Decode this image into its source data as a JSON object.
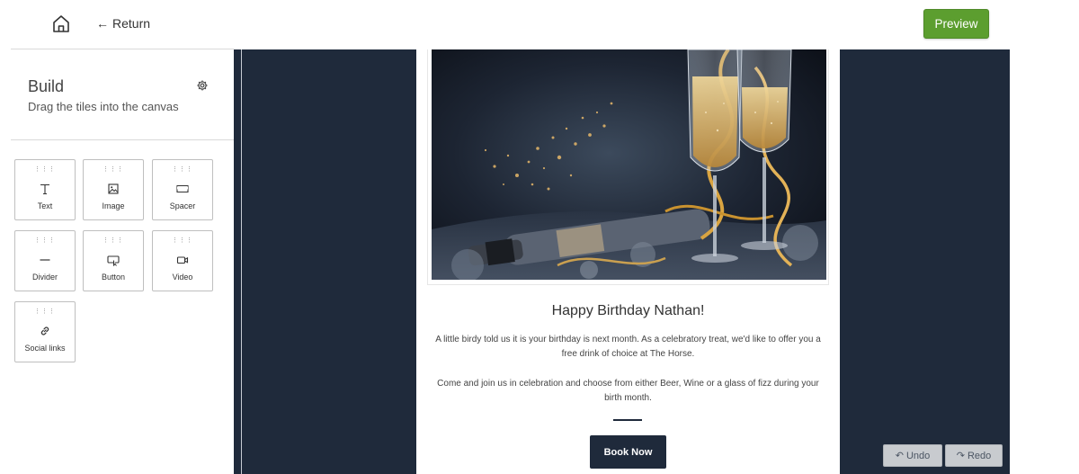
{
  "header": {
    "return_label": "Return",
    "preview_label": "Preview"
  },
  "sidebar": {
    "title": "Build",
    "subtitle": "Drag the tiles into the canvas",
    "tiles": [
      {
        "label": "Text",
        "icon": "text-icon"
      },
      {
        "label": "Image",
        "icon": "image-icon"
      },
      {
        "label": "Spacer",
        "icon": "spacer-icon"
      },
      {
        "label": "Divider",
        "icon": "divider-icon"
      },
      {
        "label": "Button",
        "icon": "button-icon"
      },
      {
        "label": "Video",
        "icon": "video-icon"
      },
      {
        "label": "Social links",
        "icon": "link-icon"
      }
    ]
  },
  "email": {
    "headline": "Happy Birthday Nathan!",
    "paragraph1": "A little birdy told us it is your birthday is next month. As a celebratory treat, we'd like to offer you a free drink of choice at The Horse.",
    "paragraph2": "Come and join us in celebration and choose from either Beer, Wine or a glass of fizz during your birth month.",
    "button_label": "Book Now"
  },
  "history": {
    "undo_label": "Undo",
    "redo_label": "Redo"
  },
  "colors": {
    "canvas_bg": "#1f2a3b",
    "preview_green": "#5c9e2f",
    "button_dark": "#1f2a3b"
  }
}
